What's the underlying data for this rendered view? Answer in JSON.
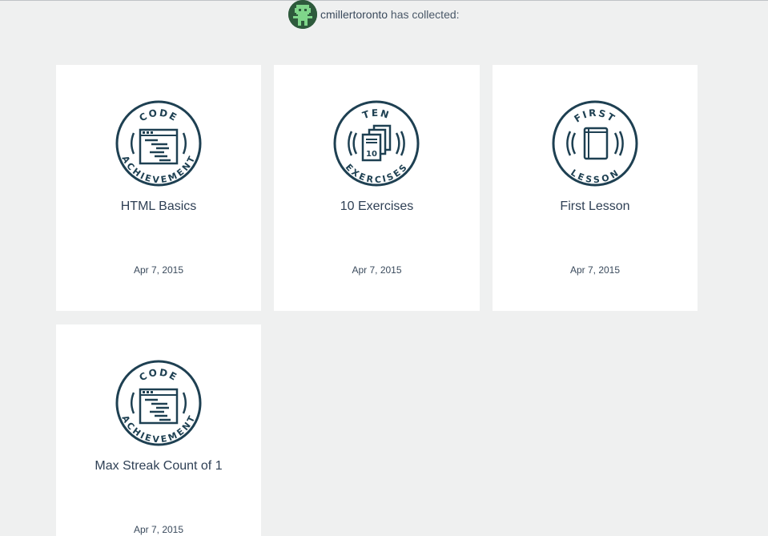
{
  "header": {
    "username": "cmillertoronto",
    "suffix": " has collected:"
  },
  "colors": {
    "background": "#eff0f0",
    "card": "#ffffff",
    "badge_stroke": "#1e4052",
    "avatar_bg": "#2e5a3c",
    "avatar_figure": "#7fd68a"
  },
  "badges": [
    {
      "title": "HTML Basics",
      "date": "Apr 7, 2015",
      "icon": "code-achievement-badge-icon",
      "badge_top_text": "CODE",
      "badge_bottom_text": "ACHIEVEMENT"
    },
    {
      "title": "10 Exercises",
      "date": "Apr 7, 2015",
      "icon": "ten-exercises-badge-icon",
      "badge_top_text": "TEN",
      "badge_bottom_text": "EXERCISES",
      "badge_number": "10"
    },
    {
      "title": "First Lesson",
      "date": "Apr 7, 2015",
      "icon": "first-lesson-badge-icon",
      "badge_top_text": "FIRST",
      "badge_bottom_text": "LESSON"
    },
    {
      "title": "Max Streak Count of 1",
      "date": "Apr 7, 2015",
      "icon": "code-achievement-badge-icon",
      "badge_top_text": "CODE",
      "badge_bottom_text": "ACHIEVEMENT"
    }
  ]
}
